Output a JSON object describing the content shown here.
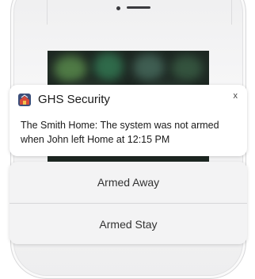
{
  "notification": {
    "app_name": "GHS Security",
    "close_label": "x",
    "message": "The Smith Home: The system was not armed when John left Home at 12:15 PM",
    "app_icon": "house-shield-icon"
  },
  "actions": [
    {
      "label": "Armed Away"
    },
    {
      "label": "Armed Stay"
    }
  ],
  "colors": {
    "card_background": "#ffffff",
    "actions_background": "#f3f3f4",
    "phone_body": "#f1f1f2",
    "screen_background": "#1d2722"
  }
}
